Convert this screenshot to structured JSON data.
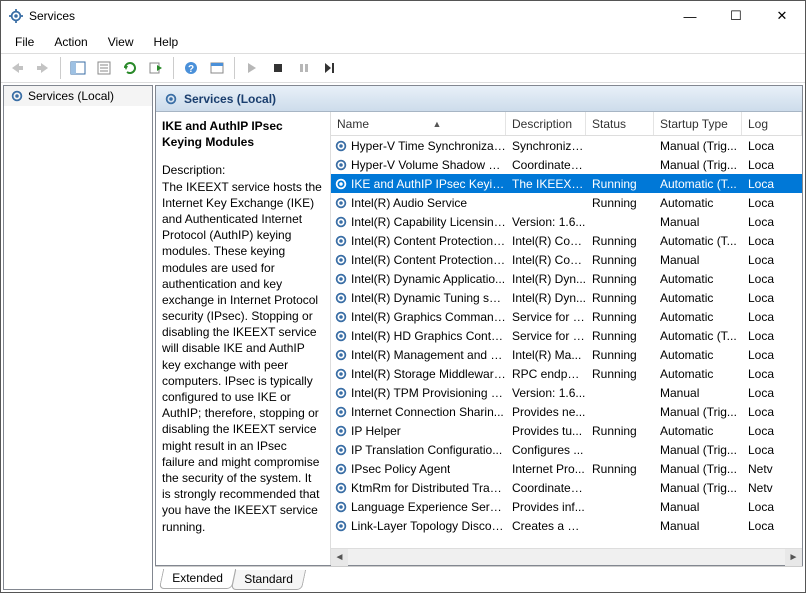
{
  "titlebar": {
    "title": "Services"
  },
  "menu": {
    "file": "File",
    "action": "Action",
    "view": "View",
    "help": "Help"
  },
  "tree": {
    "root": "Services (Local)"
  },
  "header": {
    "label": "Services (Local)"
  },
  "detail": {
    "title": "IKE and AuthIP IPsec Keying Modules",
    "desc_label": "Description:",
    "desc_text": "The IKEEXT service hosts the Internet Key Exchange (IKE) and Authenticated Internet Protocol (AuthIP) keying modules. These keying modules are used for authentication and key exchange in Internet Protocol security (IPsec). Stopping or disabling the IKEEXT service will disable IKE and AuthIP key exchange with peer computers. IPsec is typically configured to use IKE or AuthIP; therefore, stopping or disabling the IKEEXT service might result in an IPsec failure and might compromise the security of the system. It is strongly recommended that you have the IKEEXT service running."
  },
  "columns": {
    "name": "Name",
    "description": "Description",
    "status": "Status",
    "startup": "Startup Type",
    "logon": "Log"
  },
  "rows": [
    {
      "name": "Hyper-V Time Synchronizati...",
      "desc": "Synchronize...",
      "status": "",
      "start": "Manual (Trig...",
      "log": "Loca"
    },
    {
      "name": "Hyper-V Volume Shadow C...",
      "desc": "Coordinates...",
      "status": "",
      "start": "Manual (Trig...",
      "log": "Loca"
    },
    {
      "name": "IKE and AuthIP IPsec Keying...",
      "desc": "The IKEEXT ...",
      "status": "Running",
      "start": "Automatic (T...",
      "log": "Loca",
      "selected": true
    },
    {
      "name": "Intel(R) Audio Service",
      "desc": "",
      "status": "Running",
      "start": "Automatic",
      "log": "Loca"
    },
    {
      "name": "Intel(R) Capability Licensing...",
      "desc": "Version: 1.6...",
      "status": "",
      "start": "Manual",
      "log": "Loca"
    },
    {
      "name": "Intel(R) Content Protection ...",
      "desc": "Intel(R) Con...",
      "status": "Running",
      "start": "Automatic (T...",
      "log": "Loca"
    },
    {
      "name": "Intel(R) Content Protection ...",
      "desc": "Intel(R) Con...",
      "status": "Running",
      "start": "Manual",
      "log": "Loca"
    },
    {
      "name": "Intel(R) Dynamic Applicatio...",
      "desc": "Intel(R) Dyn...",
      "status": "Running",
      "start": "Automatic",
      "log": "Loca"
    },
    {
      "name": "Intel(R) Dynamic Tuning ser...",
      "desc": "Intel(R) Dyn...",
      "status": "Running",
      "start": "Automatic",
      "log": "Loca"
    },
    {
      "name": "Intel(R) Graphics Command...",
      "desc": "Service for I...",
      "status": "Running",
      "start": "Automatic",
      "log": "Loca"
    },
    {
      "name": "Intel(R) HD Graphics Contro...",
      "desc": "Service for I...",
      "status": "Running",
      "start": "Automatic (T...",
      "log": "Loca"
    },
    {
      "name": "Intel(R) Management and S...",
      "desc": "Intel(R) Ma...",
      "status": "Running",
      "start": "Automatic",
      "log": "Loca"
    },
    {
      "name": "Intel(R) Storage Middleware...",
      "desc": "RPC endpoi...",
      "status": "Running",
      "start": "Automatic",
      "log": "Loca"
    },
    {
      "name": "Intel(R) TPM Provisioning S...",
      "desc": "Version: 1.6...",
      "status": "",
      "start": "Manual",
      "log": "Loca"
    },
    {
      "name": "Internet Connection Sharin...",
      "desc": "Provides ne...",
      "status": "",
      "start": "Manual (Trig...",
      "log": "Loca"
    },
    {
      "name": "IP Helper",
      "desc": "Provides tu...",
      "status": "Running",
      "start": "Automatic",
      "log": "Loca"
    },
    {
      "name": "IP Translation Configuratio...",
      "desc": "Configures ...",
      "status": "",
      "start": "Manual (Trig...",
      "log": "Loca"
    },
    {
      "name": "IPsec Policy Agent",
      "desc": "Internet Pro...",
      "status": "Running",
      "start": "Manual (Trig...",
      "log": "Netv"
    },
    {
      "name": "KtmRm for Distributed Tran...",
      "desc": "Coordinates...",
      "status": "",
      "start": "Manual (Trig...",
      "log": "Netv"
    },
    {
      "name": "Language Experience Service",
      "desc": "Provides inf...",
      "status": "",
      "start": "Manual",
      "log": "Loca"
    },
    {
      "name": "Link-Layer Topology Discov...",
      "desc": "Creates a N...",
      "status": "",
      "start": "Manual",
      "log": "Loca"
    }
  ],
  "tabs": {
    "extended": "Extended",
    "standard": "Standard"
  }
}
